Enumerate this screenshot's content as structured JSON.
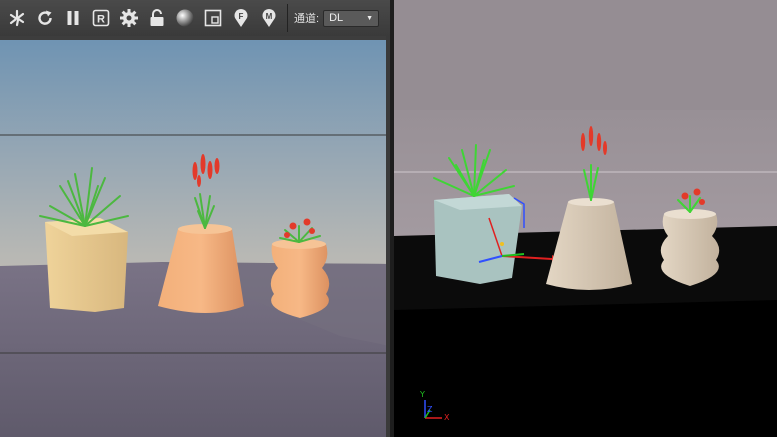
{
  "toolbar": {
    "buttons": [
      {
        "name": "render-region-icon",
        "glyph": "✇"
      },
      {
        "name": "refresh-icon",
        "glyph": "↻"
      },
      {
        "name": "pause-icon",
        "glyph": "⏸"
      },
      {
        "name": "region-r-icon",
        "glyph": "R"
      },
      {
        "name": "gear-icon",
        "glyph": "⚙"
      },
      {
        "name": "unlock-icon",
        "glyph": "🔓"
      },
      {
        "name": "material-sphere-icon",
        "glyph": ""
      },
      {
        "name": "frame-icon",
        "glyph": ""
      },
      {
        "name": "pin-f-icon",
        "glyph": "F"
      },
      {
        "name": "pin-m-icon",
        "glyph": "M"
      }
    ],
    "channel_label": "通道:",
    "channel_value": "DL",
    "dropdown_arrow": "▼"
  },
  "viewport": {
    "axis_y": "Y",
    "axis_z": "Z",
    "axis_x": "X"
  },
  "colors": {
    "toolbar_icon": "#e6e6e6",
    "sky_top": "#6e93b3",
    "sky_bottom": "#d8c3a6",
    "floor": "#6d6878",
    "viewport_bg": "#000000",
    "viewport_wall": "#8a8288",
    "pot_orange": "#f1a773",
    "pot_yellow": "#e8cc94",
    "pot_teal_selected": "#a9c3c0",
    "pot_grey": "#d8c9b5",
    "grass_green": "#3fb338",
    "flower_red": "#e33a2a",
    "axis_red": "#e02020",
    "axis_green": "#20c020",
    "axis_blue": "#3050ff"
  }
}
